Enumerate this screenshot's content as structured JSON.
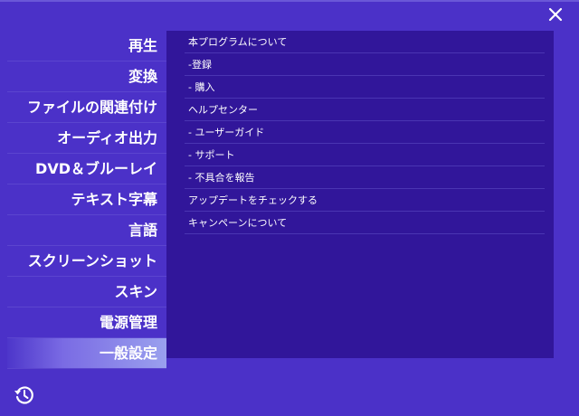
{
  "sidebar": {
    "items": [
      {
        "label": "再生"
      },
      {
        "label": "変換"
      },
      {
        "label": "ファイルの関連付け"
      },
      {
        "label": "オーディオ出力"
      },
      {
        "label": "DVD＆ブルーレイ"
      },
      {
        "label": "テキスト字幕"
      },
      {
        "label": "言語"
      },
      {
        "label": "スクリーンショット"
      },
      {
        "label": "スキン"
      },
      {
        "label": "電源管理"
      },
      {
        "label": "一般設定"
      }
    ],
    "active_index": 10
  },
  "panel": {
    "items": [
      {
        "label": "本プログラムについて"
      },
      {
        "label": "-登録"
      },
      {
        "label": "- 購入"
      },
      {
        "label": "ヘルプセンター"
      },
      {
        "label": "- ユーザーガイド"
      },
      {
        "label": "- サポート"
      },
      {
        "label": "- 不具合を報告"
      },
      {
        "label": "アップデートをチェックする"
      },
      {
        "label": "キャンペーンについて"
      }
    ]
  },
  "icons": {
    "close": "close-icon",
    "history": "history-icon"
  },
  "colors": {
    "background": "#4b31c8",
    "panel": "#31169a",
    "text": "#ffffff"
  }
}
